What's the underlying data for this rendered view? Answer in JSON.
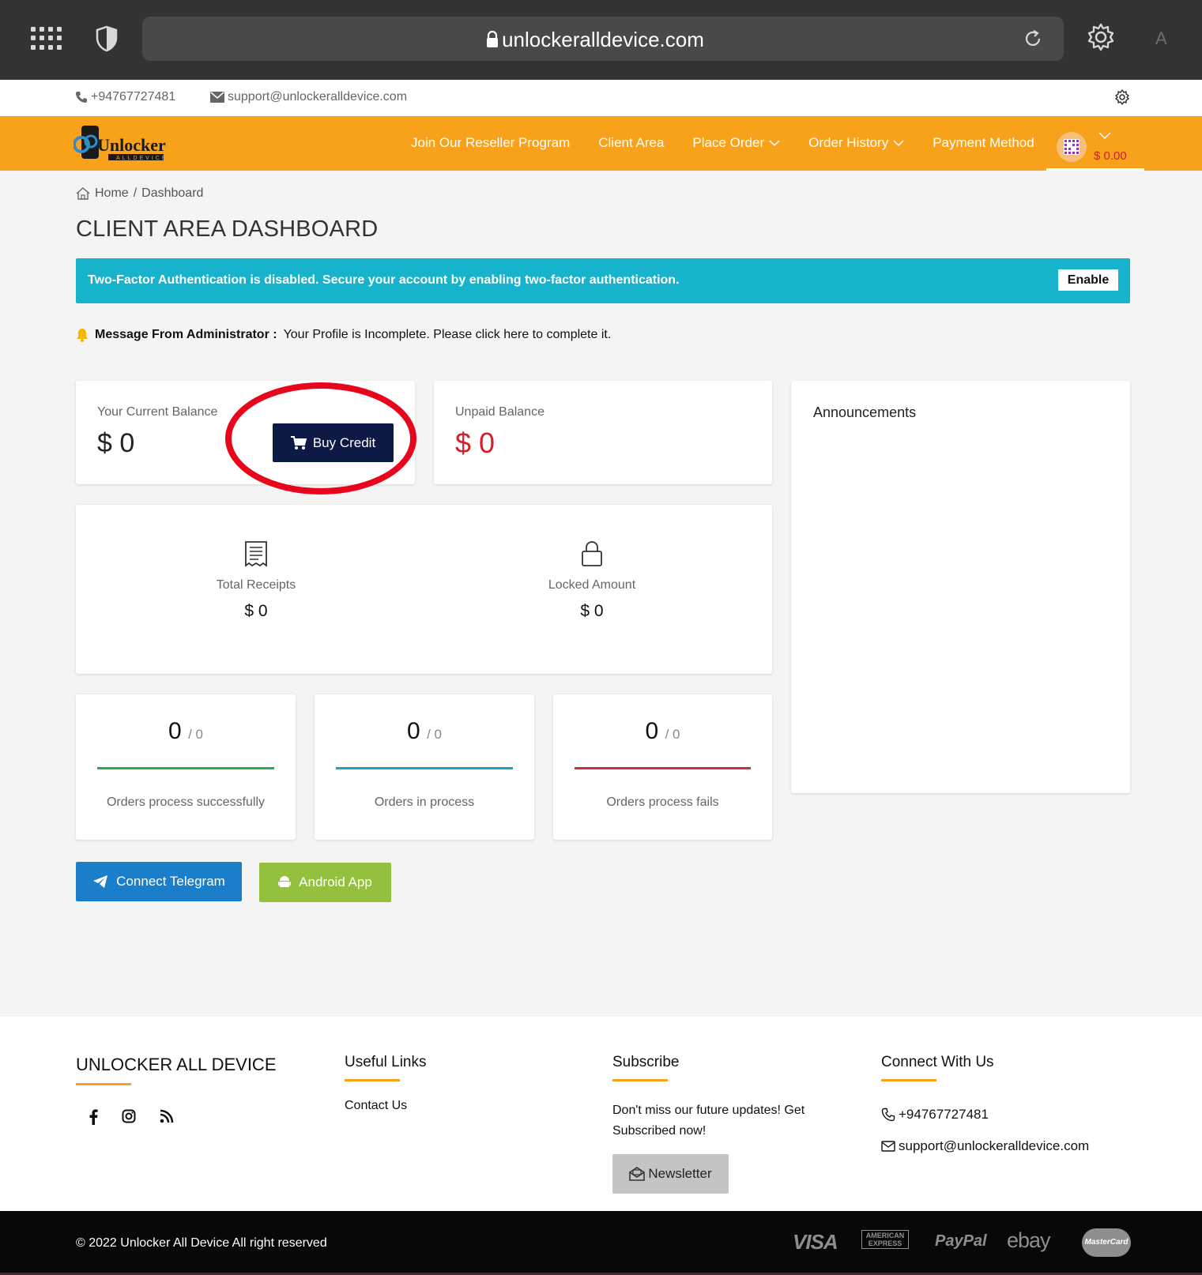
{
  "browser": {
    "url": "unlockeralldevice.com",
    "profile_initial": "A"
  },
  "topbar": {
    "phone": "+94767727481",
    "email": "support@unlockeralldevice.com"
  },
  "nav": {
    "logo_text": "Unlocker",
    "logo_sub": "ALLDEVICE",
    "items": [
      {
        "label": "Join Our Reseller Program",
        "dropdown": false
      },
      {
        "label": "Client Area",
        "dropdown": false
      },
      {
        "label": "Place Order",
        "dropdown": true
      },
      {
        "label": "Order History",
        "dropdown": true
      },
      {
        "label": "Payment Method",
        "dropdown": false
      }
    ],
    "account_balance": "$ 0.00"
  },
  "breadcrumb": {
    "home": "Home",
    "separator": "/",
    "current": "Dashboard"
  },
  "page_title": "CLIENT AREA DASHBOARD",
  "alert": {
    "message": "Two-Factor Authentication is disabled. Secure your account by enabling two-factor authentication.",
    "button": "Enable"
  },
  "admin_message": {
    "label": "Message From Administrator :",
    "text": "Your Profile is Incomplete. Please click here to complete it."
  },
  "balance": {
    "label": "Your Current Balance",
    "value": "$ 0",
    "buy_button": "Buy Credit"
  },
  "unpaid": {
    "label": "Unpaid Balance",
    "value": "$ 0"
  },
  "totals": {
    "receipts_label": "Total Receipts",
    "receipts_value": "$ 0",
    "locked_label": "Locked Amount",
    "locked_value": "$ 0"
  },
  "orders": [
    {
      "count": "0",
      "total": "/ 0",
      "label": "Orders process successfully",
      "color": "#2eaa4a"
    },
    {
      "count": "0",
      "total": "/ 0",
      "label": "Orders in process",
      "color": "#1aa3c3"
    },
    {
      "count": "0",
      "total": "/ 0",
      "label": "Orders process fails",
      "color": "#d32f3a"
    }
  ],
  "announcements": {
    "title": "Announcements"
  },
  "actions": {
    "telegram": "Connect Telegram",
    "android": "Android App"
  },
  "footer": {
    "brand": "UNLOCKER ALL DEVICE",
    "useful_links_title": "Useful Links",
    "useful_links": [
      "Contact Us"
    ],
    "subscribe_title": "Subscribe",
    "subscribe_text": "Don't miss our future updates! Get Subscribed now!",
    "newsletter_button": "Newsletter",
    "connect_title": "Connect With Us",
    "phone": "+94767727481",
    "email": "support@unlockeralldevice.com",
    "copyright": "© 2022 Unlocker All Device All right reserved",
    "payment_methods": [
      "VISA",
      "AMERICAN EXPRESS",
      "PayPal",
      "ebay",
      "MasterCard"
    ]
  },
  "colors": {
    "accent": "#f8a21c",
    "alert": "#17b2cc",
    "buy_button": "#0d1a46",
    "highlight": "#e8061c",
    "telegram": "#1a7ecb",
    "android": "#93c13e",
    "negative": "#d0212b"
  }
}
